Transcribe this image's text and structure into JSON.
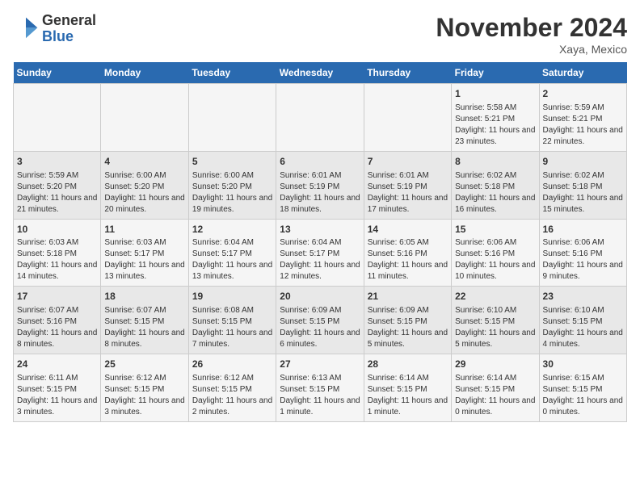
{
  "header": {
    "logo_general": "General",
    "logo_blue": "Blue",
    "month_title": "November 2024",
    "location": "Xaya, Mexico"
  },
  "weekdays": [
    "Sunday",
    "Monday",
    "Tuesday",
    "Wednesday",
    "Thursday",
    "Friday",
    "Saturday"
  ],
  "weeks": [
    [
      {
        "day": "",
        "content": ""
      },
      {
        "day": "",
        "content": ""
      },
      {
        "day": "",
        "content": ""
      },
      {
        "day": "",
        "content": ""
      },
      {
        "day": "",
        "content": ""
      },
      {
        "day": "1",
        "content": "Sunrise: 5:58 AM\nSunset: 5:21 PM\nDaylight: 11 hours and 23 minutes."
      },
      {
        "day": "2",
        "content": "Sunrise: 5:59 AM\nSunset: 5:21 PM\nDaylight: 11 hours and 22 minutes."
      }
    ],
    [
      {
        "day": "3",
        "content": "Sunrise: 5:59 AM\nSunset: 5:20 PM\nDaylight: 11 hours and 21 minutes."
      },
      {
        "day": "4",
        "content": "Sunrise: 6:00 AM\nSunset: 5:20 PM\nDaylight: 11 hours and 20 minutes."
      },
      {
        "day": "5",
        "content": "Sunrise: 6:00 AM\nSunset: 5:20 PM\nDaylight: 11 hours and 19 minutes."
      },
      {
        "day": "6",
        "content": "Sunrise: 6:01 AM\nSunset: 5:19 PM\nDaylight: 11 hours and 18 minutes."
      },
      {
        "day": "7",
        "content": "Sunrise: 6:01 AM\nSunset: 5:19 PM\nDaylight: 11 hours and 17 minutes."
      },
      {
        "day": "8",
        "content": "Sunrise: 6:02 AM\nSunset: 5:18 PM\nDaylight: 11 hours and 16 minutes."
      },
      {
        "day": "9",
        "content": "Sunrise: 6:02 AM\nSunset: 5:18 PM\nDaylight: 11 hours and 15 minutes."
      }
    ],
    [
      {
        "day": "10",
        "content": "Sunrise: 6:03 AM\nSunset: 5:18 PM\nDaylight: 11 hours and 14 minutes."
      },
      {
        "day": "11",
        "content": "Sunrise: 6:03 AM\nSunset: 5:17 PM\nDaylight: 11 hours and 13 minutes."
      },
      {
        "day": "12",
        "content": "Sunrise: 6:04 AM\nSunset: 5:17 PM\nDaylight: 11 hours and 13 minutes."
      },
      {
        "day": "13",
        "content": "Sunrise: 6:04 AM\nSunset: 5:17 PM\nDaylight: 11 hours and 12 minutes."
      },
      {
        "day": "14",
        "content": "Sunrise: 6:05 AM\nSunset: 5:16 PM\nDaylight: 11 hours and 11 minutes."
      },
      {
        "day": "15",
        "content": "Sunrise: 6:06 AM\nSunset: 5:16 PM\nDaylight: 11 hours and 10 minutes."
      },
      {
        "day": "16",
        "content": "Sunrise: 6:06 AM\nSunset: 5:16 PM\nDaylight: 11 hours and 9 minutes."
      }
    ],
    [
      {
        "day": "17",
        "content": "Sunrise: 6:07 AM\nSunset: 5:16 PM\nDaylight: 11 hours and 8 minutes."
      },
      {
        "day": "18",
        "content": "Sunrise: 6:07 AM\nSunset: 5:15 PM\nDaylight: 11 hours and 8 minutes."
      },
      {
        "day": "19",
        "content": "Sunrise: 6:08 AM\nSunset: 5:15 PM\nDaylight: 11 hours and 7 minutes."
      },
      {
        "day": "20",
        "content": "Sunrise: 6:09 AM\nSunset: 5:15 PM\nDaylight: 11 hours and 6 minutes."
      },
      {
        "day": "21",
        "content": "Sunrise: 6:09 AM\nSunset: 5:15 PM\nDaylight: 11 hours and 5 minutes."
      },
      {
        "day": "22",
        "content": "Sunrise: 6:10 AM\nSunset: 5:15 PM\nDaylight: 11 hours and 5 minutes."
      },
      {
        "day": "23",
        "content": "Sunrise: 6:10 AM\nSunset: 5:15 PM\nDaylight: 11 hours and 4 minutes."
      }
    ],
    [
      {
        "day": "24",
        "content": "Sunrise: 6:11 AM\nSunset: 5:15 PM\nDaylight: 11 hours and 3 minutes."
      },
      {
        "day": "25",
        "content": "Sunrise: 6:12 AM\nSunset: 5:15 PM\nDaylight: 11 hours and 3 minutes."
      },
      {
        "day": "26",
        "content": "Sunrise: 6:12 AM\nSunset: 5:15 PM\nDaylight: 11 hours and 2 minutes."
      },
      {
        "day": "27",
        "content": "Sunrise: 6:13 AM\nSunset: 5:15 PM\nDaylight: 11 hours and 1 minute."
      },
      {
        "day": "28",
        "content": "Sunrise: 6:14 AM\nSunset: 5:15 PM\nDaylight: 11 hours and 1 minute."
      },
      {
        "day": "29",
        "content": "Sunrise: 6:14 AM\nSunset: 5:15 PM\nDaylight: 11 hours and 0 minutes."
      },
      {
        "day": "30",
        "content": "Sunrise: 6:15 AM\nSunset: 5:15 PM\nDaylight: 11 hours and 0 minutes."
      }
    ]
  ]
}
